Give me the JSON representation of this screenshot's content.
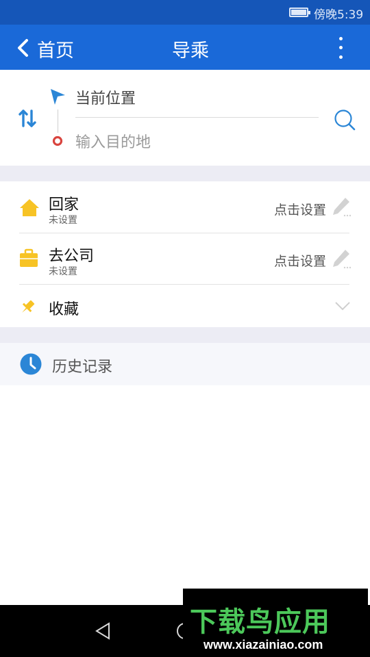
{
  "status_bar": {
    "time": "傍晚5:39",
    "battery_level": 1.0
  },
  "header": {
    "back_label": "首页",
    "title": "导乘"
  },
  "route": {
    "origin": "当前位置",
    "destination_placeholder": "输入目的地"
  },
  "places": [
    {
      "name": "回家",
      "status": "未设置",
      "action": "点击设置"
    },
    {
      "name": "去公司",
      "status": "未设置",
      "action": "点击设置"
    },
    {
      "name": "收藏"
    }
  ],
  "history": {
    "label": "历史记录"
  },
  "watermark": {
    "brand": "下载鸟应用",
    "url": "www.xiazainiao.com"
  },
  "colors": {
    "status_bar": "#1556b8",
    "app_bar": "#1a69d8",
    "accent": "#2b86d6",
    "icon_yellow": "#f7c325",
    "destination_red": "#d9453f",
    "section_gap": "#ececf4"
  },
  "icons": {
    "back": "chevron-left-icon",
    "menu": "more-vertical-icon",
    "swap": "swap-vertical-icon",
    "origin": "location-arrow-icon",
    "destination": "destination-dot-icon",
    "search": "search-icon",
    "home": "house-icon",
    "work": "briefcase-icon",
    "favorites": "pin-icon",
    "expand": "chevron-down-icon",
    "edit": "pencil-icon",
    "history": "clock-icon"
  }
}
